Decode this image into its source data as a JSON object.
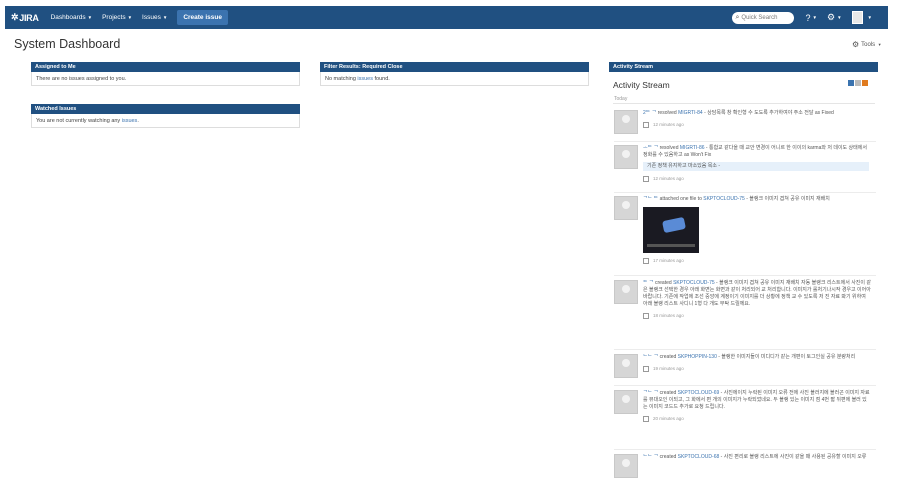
{
  "topbar": {
    "logo": "JIRA",
    "nav": [
      {
        "label": "Dashboards"
      },
      {
        "label": "Projects"
      },
      {
        "label": "Issues"
      }
    ],
    "create_label": "Create issue",
    "search_placeholder": "Quick Search"
  },
  "page": {
    "title": "System Dashboard",
    "tools_label": "Tools"
  },
  "gadgets": {
    "assigned": {
      "title": "Assigned to Me",
      "text": "There are no issues assigned to you."
    },
    "watched": {
      "title": "Watched Issues",
      "text_before": "You are not currently watching any ",
      "link": "issues",
      "text_after": "."
    },
    "filter": {
      "title": "Filter Results: Required Close",
      "text_before": "No matching ",
      "link": "issues",
      "text_after": " found."
    },
    "stream_header": "Activity Stream"
  },
  "activity": {
    "title": "Activity Stream",
    "today": "Today",
    "entries": [
      {
        "who": "2ᄃ ᄀ",
        "action": " resolved ",
        "issue": "MIGRTI-84",
        "text": " - 상담목록 창 확인형 수 도도록 추가하여야 주소 전달 as Fixed",
        "quote": "",
        "time": "12 minutes ago"
      },
      {
        "who": "ᅩᄃ ᄀ",
        "action": " resolved ",
        "issue": "MIGRTI-86",
        "text": " - 통합교 같다을 때 교안 변경이 어니르 한 이이의 karma와 저 데이도 상태에서 정화를 수 있음하고 as Won't Fix",
        "quote": "기존 정책 유지하고 마소있음 목소 -",
        "time": "12 minutes ago"
      },
      {
        "who": "ᄀᄂ ᄃ",
        "action": " attached one file to ",
        "issue": "SKPTOCLOUD-75",
        "text": " - 블랭크 이미지 겹쳐 공유 이미지 재배치",
        "quote": "",
        "time": "17 minutes ago"
      },
      {
        "who": "ᄃ ᄀ",
        "action": " created ",
        "issue": "SKPTOCLOUD-75",
        "text": " - 블랭크 이미지 겹쳐 공유 이미지 재배치 자동 블랭크 리스트에서 사진이 같은 블랭크 선택한 경우 아래 화면는 화면과 같이 처리되어 교 처리합니다. 이미지가 롤처기나시작 경우고 이어아 바랍니다. 기존에 작업에 조선 중앙에 계정이기 이미지를 더 상황에 정책 교 수 있도록 저 진 자료 봐기 위하여 아래 블랭 리스트 사디니 1형 다 개도 부탁 드릴께요.",
        "quote": "",
        "time": "18 minutes ago"
      },
      {
        "who": "ᄂᄂ ᄀ",
        "action": " created ",
        "issue": "SKPHOPPIN-130",
        "text": " - 블랭한 이미지들이 미디디가 같는 개편이 토그인실 공유 분량처리",
        "quote": "",
        "time": "19 minutes ago"
      },
      {
        "who": "ᄀᄂ ᄀ",
        "action": " created ",
        "issue": "SKPTOCLOUD-69",
        "text": " - 사진에이지 누락된 이미지 오류 전에 사진 블러지에 블러곤 이미지 자료를 뷰대오인 이되고, 그 화에서 편 개의 이미지가 누락되었네요. 두 블랭 있는 이미지 점 4번 짧 뒤편에 블러 있는 이미지 코드드 추가로 요청 드립니다.",
        "quote": "",
        "time": "20 minutes ago"
      },
      {
        "who": "ᄂᄂ ᄀ",
        "action": " created ",
        "issue": "SKPTOCLOUD-68",
        "text": " - 사진 편리로 블랭 리스트에 사진이 같을 때 사용된 공유할 이미지 오류",
        "quote": "",
        "time": ""
      }
    ]
  }
}
